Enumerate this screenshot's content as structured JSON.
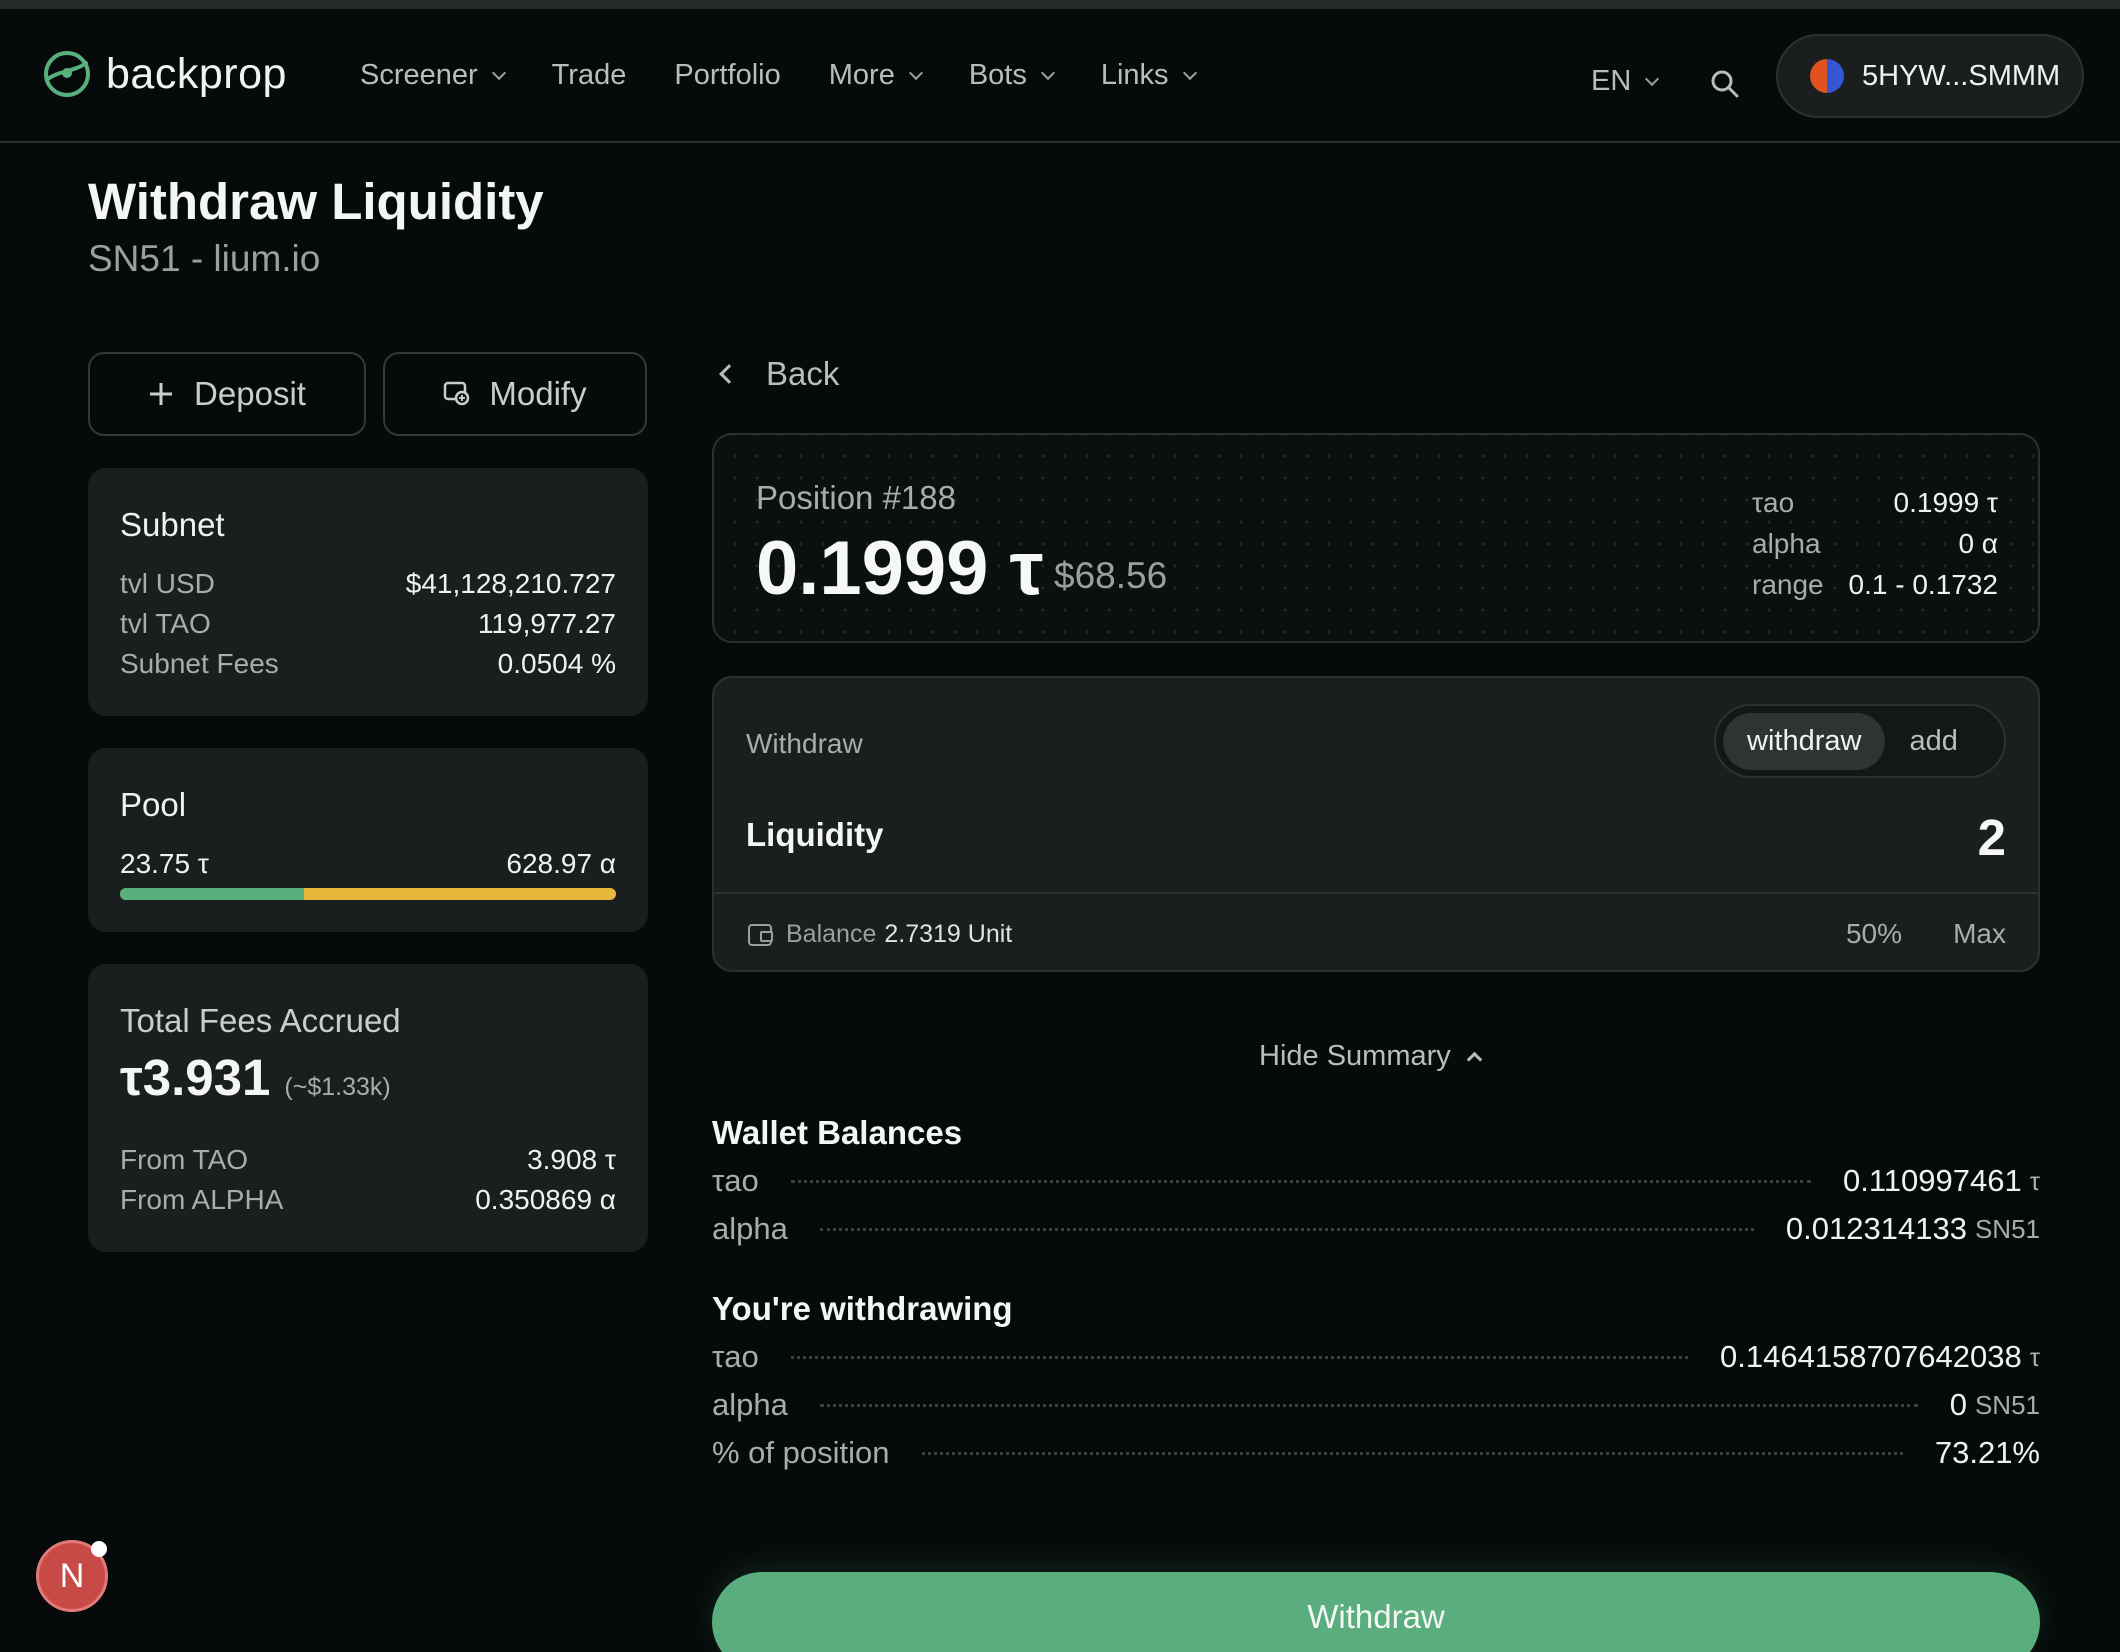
{
  "header": {
    "logo": "backprop",
    "nav": [
      {
        "label": "Screener",
        "dropdown": true
      },
      {
        "label": "Trade",
        "dropdown": false
      },
      {
        "label": "Portfolio",
        "dropdown": false
      },
      {
        "label": "More",
        "dropdown": true
      },
      {
        "label": "Bots",
        "dropdown": true
      },
      {
        "label": "Links",
        "dropdown": true
      }
    ],
    "language": "EN",
    "wallet_address": "5HYW...SMMM"
  },
  "page": {
    "title": "Withdraw Liquidity",
    "subtitle": "SN51 - lium.io"
  },
  "actions": {
    "deposit_label": "Deposit",
    "modify_label": "Modify"
  },
  "subnet": {
    "title": "Subnet",
    "rows": [
      {
        "key": "tvl USD",
        "value": "$41,128,210.727"
      },
      {
        "key": "tvl TAO",
        "value": "119,977.27"
      },
      {
        "key": "Subnet Fees",
        "value": "0.0504 %"
      }
    ]
  },
  "pool": {
    "title": "Pool",
    "tao": "23.75 τ",
    "alpha": "628.97 α",
    "tao_share": 0.37
  },
  "fees": {
    "title": "Total Fees Accrued",
    "total": "τ3.931",
    "usd": "(~$1.33k)",
    "rows": [
      {
        "key": "From TAO",
        "value": "3.908 τ"
      },
      {
        "key": "From ALPHA",
        "value": "0.350869 α"
      }
    ]
  },
  "back_label": "Back",
  "position": {
    "label": "Position #188",
    "value": "0.1999 τ",
    "usd": "$68.56",
    "stats": [
      {
        "key": "τao",
        "value": "0.1999 τ"
      },
      {
        "key": "alpha",
        "value": "0 α"
      },
      {
        "key": "range",
        "value": "0.1 - 0.1732"
      }
    ]
  },
  "withdraw_form": {
    "label": "Withdraw",
    "toggle": [
      "withdraw",
      "add"
    ],
    "liquidity_label": "Liquidity",
    "liquidity_value": "2",
    "balance_label": "Balance",
    "balance_value": "2.7319 Unit",
    "pct_50": "50%",
    "max": "Max"
  },
  "summary_toggle": "Hide Summary",
  "wallet_balances": {
    "title": "Wallet Balances",
    "rows": [
      {
        "key": "τao",
        "value": "0.110997461",
        "unit": "τ"
      },
      {
        "key": "alpha",
        "value": "0.012314133",
        "unit": "SN51"
      }
    ]
  },
  "withdrawing": {
    "title": "You're withdrawing",
    "rows": [
      {
        "key": "τao",
        "value": "0.1464158707642038",
        "unit": "τ"
      },
      {
        "key": "alpha",
        "value": "0",
        "unit": "SN51"
      },
      {
        "key": "% of position",
        "value": "73.21%",
        "unit": ""
      }
    ]
  },
  "submit_label": "Withdraw",
  "badge_letter": "N",
  "colors": {
    "accent_green": "#5aad7d",
    "pool_tao": "#57b07d",
    "pool_alpha": "#e8b83a",
    "badge_red": "#c74a47"
  }
}
